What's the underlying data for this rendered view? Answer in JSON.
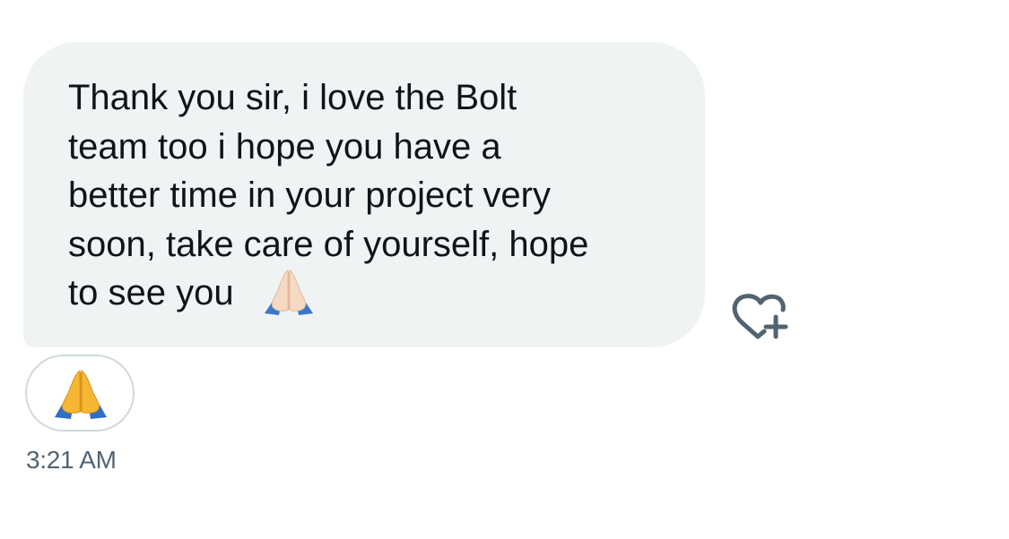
{
  "message": {
    "text": "Thank you sir, i love the Bolt\nteam too i hope you have a\nbetter time in your project very\nsoon, take care of yourself, hope\nto see you",
    "inline_emoji_icon": "folded-hands-light-skin-icon",
    "timestamp": "3:21 AM"
  },
  "actions": {
    "add_reaction_icon": "heart-plus-icon"
  },
  "reactions": [
    {
      "icon": "folded-hands-icon"
    }
  ],
  "colors": {
    "bubble_bg": "#eff3f4",
    "text": "#0f1419",
    "muted": "#536471",
    "pill_border": "#cfd9de"
  }
}
